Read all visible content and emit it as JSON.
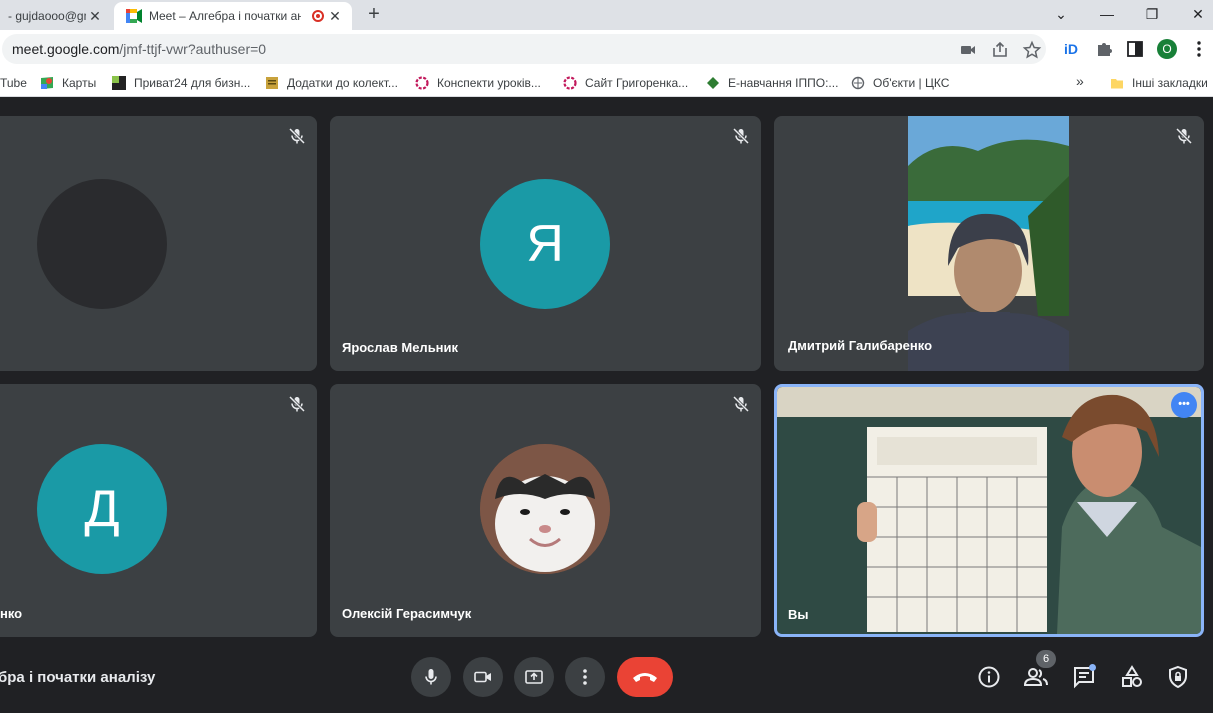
{
  "browser": {
    "tabs": [
      {
        "title": "- gujdaooo@gm",
        "active": false
      },
      {
        "title": "Meet – Алгебра і початки аналізу",
        "active": true,
        "recording": true
      }
    ],
    "new_tab": "+",
    "window_controls": {
      "tab_search": "⌄",
      "minimize": "—",
      "restore": "❐",
      "close": "✕"
    },
    "url_host": "meet.google.com",
    "url_path": "/jmf-ttjf-vwr?authuser=0",
    "profile_initial": "O"
  },
  "bookmarks": {
    "items": [
      {
        "label": "Tube",
        "icon": "youtube-icon"
      },
      {
        "label": "Карты",
        "icon": "maps-icon"
      },
      {
        "label": "Приват24 для бизн...",
        "icon": "privat-icon"
      },
      {
        "label": "Додатки до колект...",
        "icon": "doc-icon"
      },
      {
        "label": "Конспекти уроків...",
        "icon": "flower-icon"
      },
      {
        "label": "Сайт Григоренка...",
        "icon": "flower-icon"
      },
      {
        "label": "Е-навчання ІППО:...",
        "icon": "leaf-icon"
      },
      {
        "label": "Об'єкти | ЦКС",
        "icon": "globe-icon"
      }
    ],
    "more": "»",
    "other": "Інші закладки"
  },
  "participants": [
    {
      "name": "",
      "avatar_letter": "",
      "muted": true
    },
    {
      "name": "Ярослав Мельник",
      "avatar_letter": "Я",
      "muted": true
    },
    {
      "name": "Дмитрий Галибаренко",
      "avatar_letter": "",
      "muted": true
    },
    {
      "name": "нко",
      "avatar_letter": "Д",
      "muted": true
    },
    {
      "name": "Олексій Герасимчук",
      "avatar_letter": "",
      "muted": false
    },
    {
      "name": "Вы",
      "avatar_letter": "",
      "muted": false
    }
  ],
  "self_tile_menu": "•••",
  "meeting_title": "бра і початки аналізу",
  "people_count": "6",
  "colors": {
    "accent_teal": "#1a9aa6",
    "hangup_red": "#ea4335",
    "tile_bg": "#3c4043",
    "stage_bg": "#202124",
    "active_border": "#8ab4f8"
  }
}
